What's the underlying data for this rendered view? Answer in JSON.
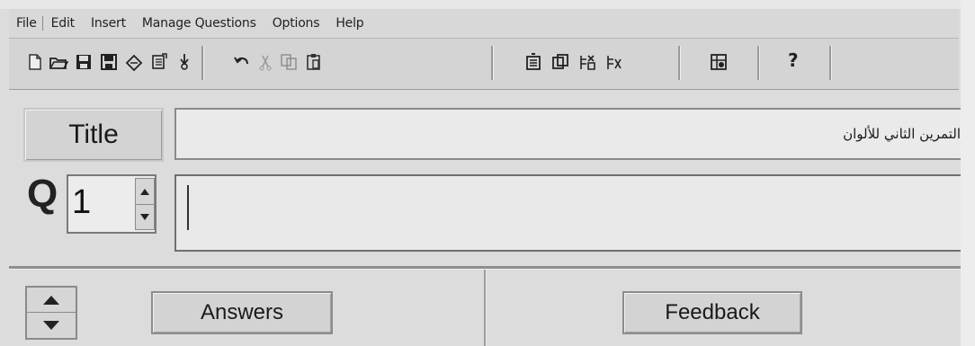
{
  "menu": {
    "items": [
      "File",
      "Edit",
      "Insert",
      "Manage Questions",
      "Options",
      "Help"
    ]
  },
  "toolbar": {
    "icons": [
      "new-file-icon",
      "open-folder-icon",
      "save-icon",
      "save-as-icon",
      "eraser-icon",
      "export-icon",
      "pin-icon",
      "undo-icon",
      "cut-icon",
      "copy-icon",
      "paste-icon",
      "add-question-icon",
      "duplicate-question-icon",
      "insert-question-icon",
      "delete-question-icon",
      "preview-icon",
      "help-icon"
    ],
    "help_label": "?"
  },
  "title_row": {
    "label": "Title",
    "value": "التمرين الثاني للألوان"
  },
  "question_row": {
    "label": "Q",
    "number": "1",
    "text": ""
  },
  "bottom": {
    "answers_label": "Answers",
    "feedback_label": "Feedback"
  }
}
